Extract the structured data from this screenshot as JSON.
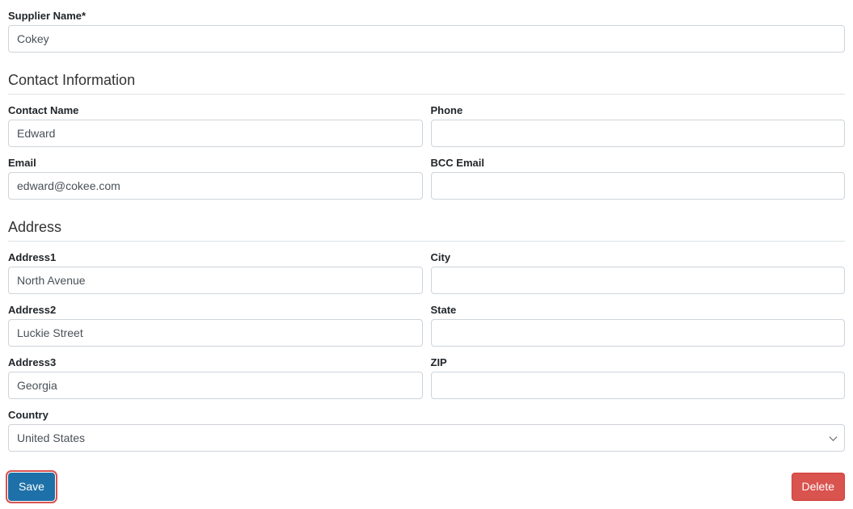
{
  "supplier": {
    "name_label": "Supplier Name*",
    "name_value": "Cokey"
  },
  "contact": {
    "section_title": "Contact Information",
    "name_label": "Contact Name",
    "name_value": "Edward",
    "phone_label": "Phone",
    "phone_value": "",
    "email_label": "Email",
    "email_value": "edward@cokee.com",
    "bcc_label": "BCC Email",
    "bcc_value": ""
  },
  "address": {
    "section_title": "Address",
    "address1_label": "Address1",
    "address1_value": "North Avenue",
    "address2_label": "Address2",
    "address2_value": "Luckie Street",
    "address3_label": "Address3",
    "address3_value": "Georgia",
    "city_label": "City",
    "city_value": "",
    "state_label": "State",
    "state_value": "",
    "zip_label": "ZIP",
    "zip_value": "",
    "country_label": "Country",
    "country_value": "United States"
  },
  "actions": {
    "save_label": "Save",
    "delete_label": "Delete"
  }
}
